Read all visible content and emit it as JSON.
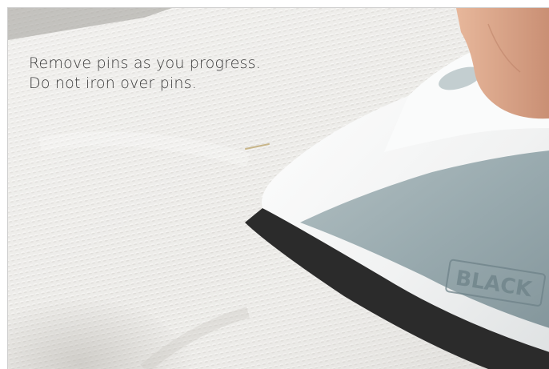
{
  "caption": {
    "line1": "Remove pins as you progress.",
    "line2": "Do not iron over pins."
  },
  "iron": {
    "brand_text": "BLACK"
  },
  "colors": {
    "fabric": "#ebeae7",
    "fabric_shadow": "#d8d6d2",
    "iron_body": "#f4f5f5",
    "iron_window": "#8ea1a6",
    "soleplate_edge": "#2a2a2a",
    "caption_text": "#3b3b3b",
    "skin": "#d9a88c"
  }
}
